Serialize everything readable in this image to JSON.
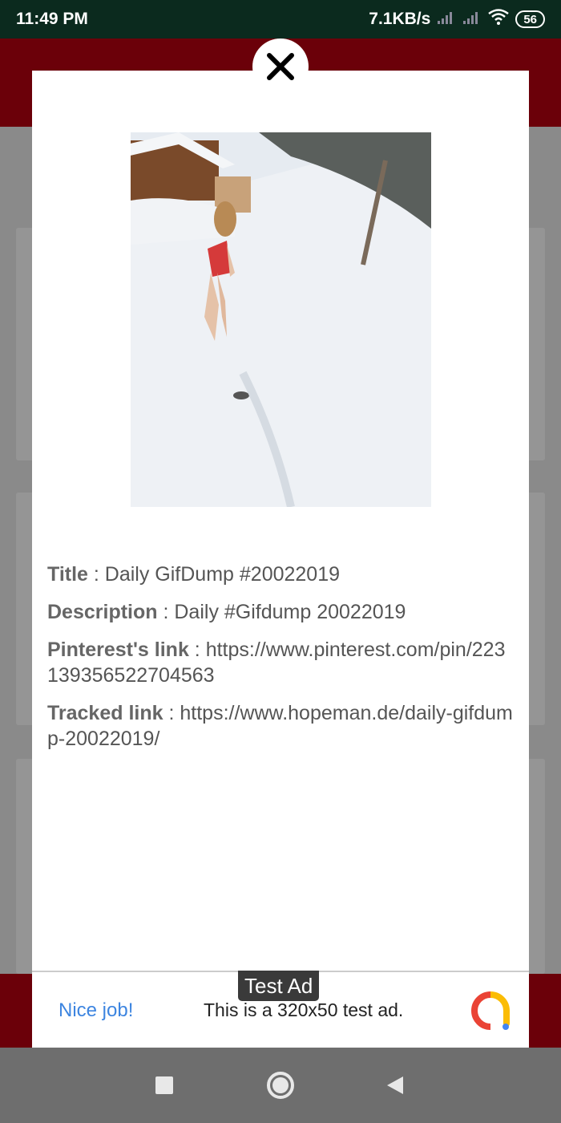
{
  "status_bar": {
    "time": "11:49 PM",
    "network_speed": "7.1KB/s",
    "battery_level": "56",
    "icons": [
      "signal-icon",
      "signal-icon",
      "wifi-icon",
      "battery-icon"
    ]
  },
  "dialog": {
    "close_icon": "close-icon",
    "fields": [
      {
        "key": "Title",
        "value": "Daily GifDump #20022019"
      },
      {
        "key": "Description",
        "value": "Daily #Gifdump 20022019"
      },
      {
        "key": "Pinterest's link",
        "value": "https://www.pinterest.com/pin/223139356522704563"
      },
      {
        "key": "Tracked link",
        "value": "https://www.hopeman.de/daily-gifdump-20022019/"
      }
    ],
    "separator": " : "
  },
  "ad": {
    "badge": "Test Ad",
    "cta": "Nice job!",
    "text": "This is a 320x50 test ad.",
    "logo_icon": "admob-logo-icon"
  },
  "navbar": {
    "icons": [
      "recents-square-icon",
      "home-circle-icon",
      "back-triangle-icon"
    ]
  },
  "colors": {
    "app_bar": "#b0000f",
    "status_bar": "#0b2a1e",
    "link_blue": "#3d85e0"
  }
}
